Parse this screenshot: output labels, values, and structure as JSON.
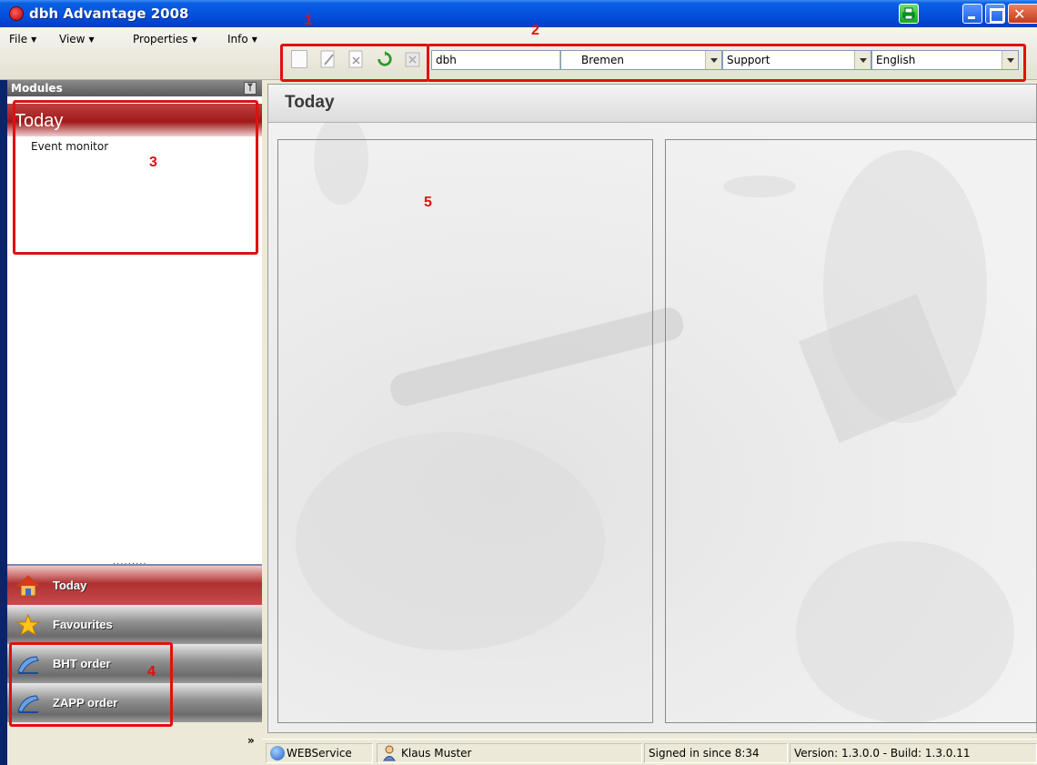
{
  "window": {
    "title": "dbh Advantage 2008"
  },
  "menu": {
    "items": [
      "File",
      "View",
      "Properties",
      "Info"
    ]
  },
  "toolbar": {
    "icons": [
      "new-document-icon",
      "edit-document-icon",
      "delete-document-icon",
      "refresh-icon",
      "close-document-icon"
    ],
    "combos": [
      {
        "value": "dbh"
      },
      {
        "value": "Bremen"
      },
      {
        "value": "Support"
      },
      {
        "value": "English"
      }
    ]
  },
  "callouts": [
    "1",
    "2",
    "3",
    "4",
    "5"
  ],
  "sidebar": {
    "header": "Modules",
    "pin_glyph": "⚓",
    "section_title": "Today",
    "items": [
      "Event monitor"
    ],
    "splitter_dots": ".........",
    "nav": [
      {
        "label": "Today",
        "icon": "home-icon"
      },
      {
        "label": "Favourites",
        "icon": "star-icon"
      },
      {
        "label": "BHT order",
        "icon": "order-icon"
      },
      {
        "label": "ZAPP order",
        "icon": "order-icon"
      }
    ],
    "more": "»"
  },
  "main": {
    "title": "Today"
  },
  "status": {
    "service": "WEBService",
    "user": "Klaus Muster",
    "signed_in": "Signed in since 8:34",
    "version": "Version: 1.3.0.0 - Build: 1.3.0.11"
  },
  "colors": {
    "accent_red": "#a01818",
    "callout_red": "#e01010",
    "titlebar_blue": "#0554df"
  }
}
